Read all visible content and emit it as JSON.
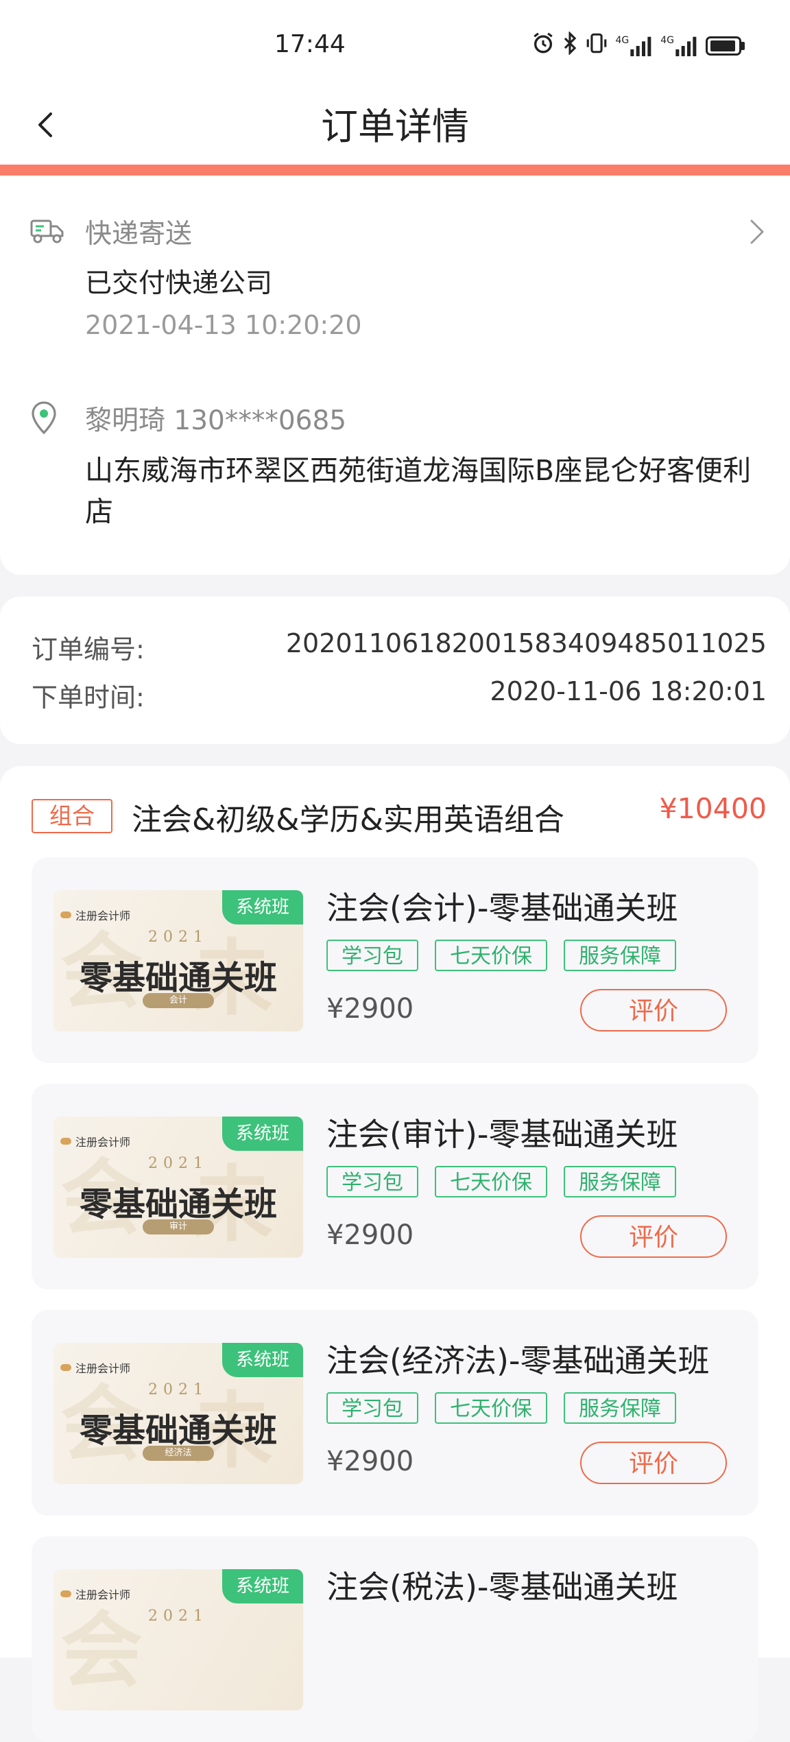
{
  "status_bar": {
    "time": "17:44",
    "icons": [
      "alarm-icon",
      "bluetooth-icon",
      "vibrate-icon",
      "signal-4g-icon",
      "signal-4g-icon",
      "battery-icon"
    ],
    "network_1": "4G",
    "network_2": "4G"
  },
  "nav": {
    "title": "订单详情",
    "back_icon": "chevron-left-icon"
  },
  "accent_color": "#f97d69",
  "delivery": {
    "title": "快递寄送",
    "status": "已交付快递公司",
    "time": "2021-04-13 10:20:20",
    "recipient": "黎明琦 130****0685",
    "address": "山东威海市环翠区西苑街道龙海国际B座昆仑好客便利店",
    "truck_icon": "truck-icon",
    "pin_icon": "location-pin-icon",
    "chevron_icon": "chevron-right-icon"
  },
  "order": {
    "number_label": "订单编号:",
    "number_value": "20201106182001583409485011025",
    "time_label": "下单时间:",
    "time_value": "2020-11-06 18:20:01"
  },
  "bundle": {
    "tag": "组合",
    "title": "注会&初级&学历&实用英语组合",
    "price": "¥10400"
  },
  "courses": [
    {
      "title": "注会(会计)-零基础通关班",
      "chips": [
        "学习包",
        "七天价保",
        "服务保障"
      ],
      "price": "¥2900",
      "button": "评价",
      "thumb": {
        "corner": "系统班",
        "brand": "注册会计师",
        "year": "2021",
        "big": "零基础通关班",
        "subject": "会计"
      }
    },
    {
      "title": "注会(审计)-零基础通关班",
      "chips": [
        "学习包",
        "七天价保",
        "服务保障"
      ],
      "price": "¥2900",
      "button": "评价",
      "thumb": {
        "corner": "系统班",
        "brand": "注册会计师",
        "year": "2021",
        "big": "零基础通关班",
        "subject": "审计"
      }
    },
    {
      "title": "注会(经济法)-零基础通关班",
      "chips": [
        "学习包",
        "七天价保",
        "服务保障"
      ],
      "price": "¥2900",
      "button": "评价",
      "thumb": {
        "corner": "系统班",
        "brand": "注册会计师",
        "year": "2021",
        "big": "零基础通关班",
        "subject": "经济法"
      }
    },
    {
      "title": "注会(税法)-零基础通关班",
      "chips": [],
      "price": "",
      "button": "",
      "thumb": {
        "corner": "系统班",
        "brand": "注册会计师",
        "year": "2021",
        "big": "",
        "subject": ""
      }
    }
  ]
}
